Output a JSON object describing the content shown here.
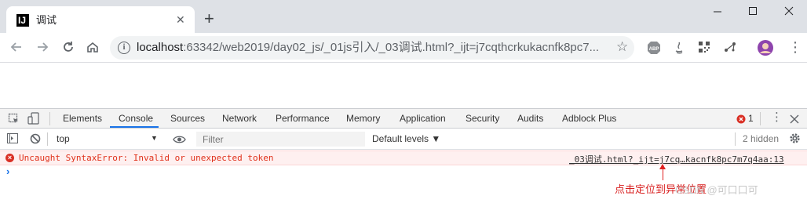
{
  "browser": {
    "tab": {
      "title": "调试",
      "favicon_letter": "IJ",
      "close": "✕"
    },
    "new_tab": "+",
    "window_controls": {
      "minimize": "—",
      "maximize": "☐",
      "close": "✕"
    },
    "nav": {
      "back": "←",
      "forward": "→",
      "reload": "↻",
      "home": "⌂"
    },
    "omnibox": {
      "host": "localhost",
      "path": ":63342/web2019/day02_js/_01js引入/_03调试.html?_ijt=j7cqthcrkukacnfk8pc7...",
      "info_icon": "i",
      "star": "☆"
    },
    "extensions": [
      {
        "name": "abp-icon",
        "label": "ABP"
      },
      {
        "name": "java-icon",
        "label": ""
      },
      {
        "name": "qrcode-icon",
        "label": ""
      },
      {
        "name": "network-icon",
        "label": ""
      },
      {
        "name": "profile-icon",
        "label": ""
      }
    ],
    "menu": "⋮"
  },
  "devtools": {
    "tabs": [
      "Elements",
      "Console",
      "Sources",
      "Network",
      "Performance",
      "Memory",
      "Application",
      "Security",
      "Audits",
      "Adblock Plus"
    ],
    "active_tab": "Console",
    "error_count": "1",
    "toolbar": {
      "context": "top",
      "filter_placeholder": "Filter",
      "levels": "Default levels ▼",
      "hidden": "2 hidden"
    },
    "console": {
      "error_message": "Uncaught SyntaxError: Invalid or unexpected token",
      "error_source": "_03调试.html?_ijt=j7cq…kacnfk8pc7m7q4aa:13",
      "prompt": "›"
    }
  },
  "annotation": {
    "text": "点击定位到异常位置",
    "color": "#e02020"
  },
  "watermark": "CSDN @可口口可",
  "colors": {
    "tabstrip_bg": "#dee1e6",
    "accent": "#1a73e8",
    "error_red": "#e0311b",
    "error_bg": "#fef0f0"
  }
}
